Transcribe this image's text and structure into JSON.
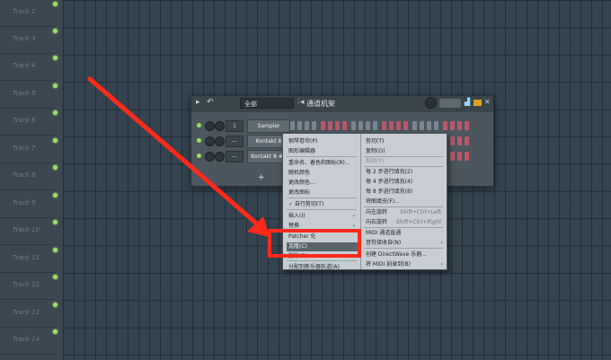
{
  "tracks": [
    "Track 2",
    "Track 3",
    "Track 4",
    "Track 5",
    "Track 6",
    "Track 7",
    "Track 8",
    "Track 9",
    "Track 10",
    "Track 11",
    "Track 12",
    "Track 13",
    "Track 14"
  ],
  "rack": {
    "preset": "全部",
    "title": "通道机架",
    "add_label": "+",
    "channels": [
      {
        "num": "1",
        "name": "Sampler"
      },
      {
        "num": "---",
        "name": "Kontakt 8"
      },
      {
        "num": "---",
        "name": "Kontakt 8 #2"
      }
    ]
  },
  "menu": {
    "left": [
      {
        "label": "钢琴卷帘(P)"
      },
      {
        "label": "图形编辑器"
      },
      {
        "label": "重命名、着色和图标(R)..."
      },
      {
        "label": "随机颜色"
      },
      {
        "label": "更改颜色..."
      },
      {
        "label": "更改图标"
      },
      {
        "label": "✓ 自行剪切(T)"
      },
      {
        "label": "插入(I)"
      },
      {
        "label": "替换"
      },
      {
        "label": "Patcher 化"
      },
      {
        "label": "克隆(C)"
      },
      {
        "label": "删除(D)"
      },
      {
        "label": "分配到新乐器轨道(A)"
      }
    ],
    "right": [
      {
        "label": "剪切(T)"
      },
      {
        "label": "复制(O)"
      },
      {
        "label": "粘贴(P)"
      },
      {
        "label": "每 2 步进行填充(2)"
      },
      {
        "label": "每 4 步进行填充(4)"
      },
      {
        "label": "每 8 步进行填充(8)"
      },
      {
        "label": "将图填充(F)..."
      },
      {
        "label": "向左旋转",
        "shortcut": "Shift+Ctrl+Left"
      },
      {
        "label": "向右旋转",
        "shortcut": "Shift+Ctrl+Right"
      },
      {
        "label": "MIDI 通道直通"
      },
      {
        "label": "音符接收自(N)"
      },
      {
        "label": "创建 DirectWave 乐器..."
      },
      {
        "label": "将 MIDI 刻录到(B)"
      }
    ]
  },
  "colors": {
    "accent_red": "#ff2a1b",
    "led_green": "#9ae35c"
  }
}
